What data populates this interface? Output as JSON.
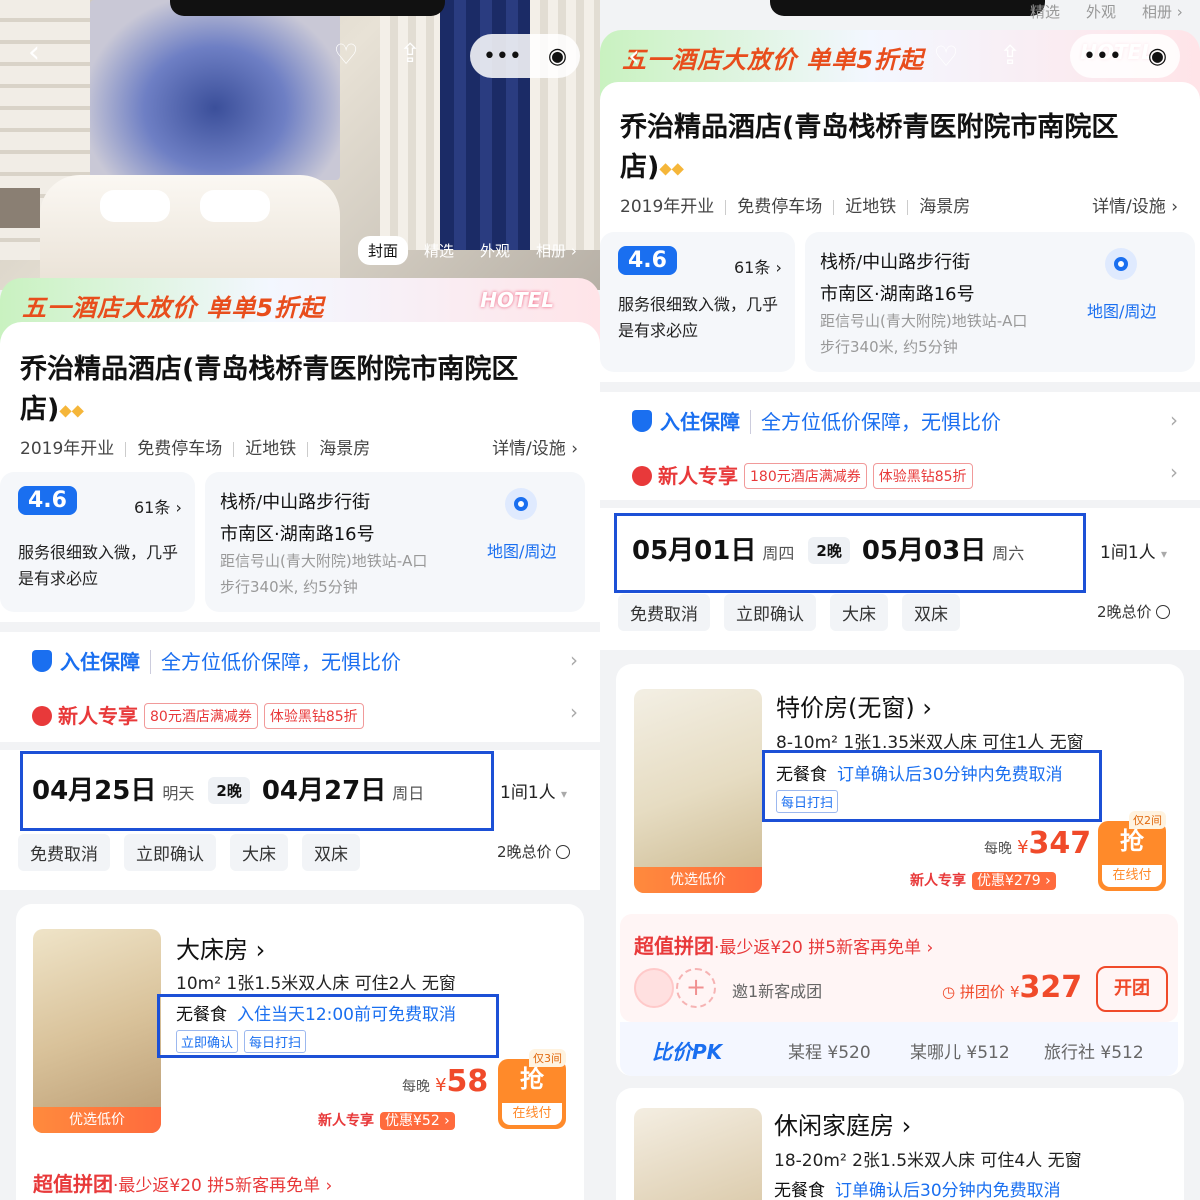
{
  "common": {
    "hotel_title": "乔治精品酒店(青岛栈桥青医附院市南院区店)",
    "diamonds": "◆◆",
    "features": [
      "2019年开业",
      "免费停车场",
      "近地铁",
      "海景房"
    ],
    "detail_link": "详情/设施 ›",
    "score": "4.6",
    "review_count": "61条 ›",
    "review_snippet": "服务很细致入微，几乎是有求必应",
    "address_line1": "栈桥/中山路步行街",
    "address_line2": "市南区·湖南路16号",
    "address_line3": "距信号山(青大附院)地铁站-A口",
    "address_line4": "步行340米, 约5分钟",
    "map_link": "地图/周边",
    "guarantee_title": "入住保障",
    "guarantee_desc": "全方位低价保障，无惧比价",
    "newuser_title": "新人专享",
    "newuser_tag2": "体验黑钻85折",
    "rooms_guests": "1间1人",
    "chips": [
      "免费取消",
      "立即确认",
      "大床",
      "双床"
    ],
    "total_price": "2晚总价",
    "banner": "五一酒店大放价 单单5折起",
    "banner_logo": "HOTEL",
    "photo_tabs": [
      "封面",
      "精选",
      "外观",
      "相册 ›"
    ],
    "nights": "2晚",
    "room_img_label": "优选低价",
    "per_night": "每晚",
    "currency": "¥",
    "grab": "抢",
    "online_pay": "在线付",
    "new_badge": "新人专享",
    "group_title": "超值拼团",
    "group_desc": "·最少返¥20 拼5新客再免单 ›",
    "daily_clean": "每日打扫",
    "no_breakfast": "无餐食"
  },
  "left": {
    "newuser_tag1": "80元酒店满减券",
    "checkin_date": "04月25日",
    "checkin_day": "明天",
    "checkout_date": "04月27日",
    "checkout_day": "周日",
    "room": {
      "name": "大床房 ›",
      "spec": "10m²  1张1.5米双人床  可住2人  无窗",
      "cancel": "入住当天12:00前可免费取消",
      "tag1": "立即确认",
      "price": "58",
      "limit": "仅3间",
      "discount": "优惠¥52 ›"
    }
  },
  "right": {
    "newuser_tag1": "180元酒店满减券",
    "checkin_date": "05月01日",
    "checkin_day": "周四",
    "checkout_date": "05月03日",
    "checkout_day": "周六",
    "room": {
      "name": "特价房(无窗) ›",
      "spec": "8-10m²  1张1.35米双人床  可住1人  无窗",
      "cancel": "订单确认后30分钟内免费取消",
      "price": "347",
      "limit": "仅2间",
      "discount": "优惠¥279 ›"
    },
    "group_invite": "邀1新客成团",
    "group_price_label": "◷ 拼团价",
    "group_price": "327",
    "group_button": "开团",
    "pk_title": "比价PK",
    "pk_items": [
      "某程 ¥520",
      "某哪儿 ¥512",
      "旅行社 ¥512"
    ],
    "room2": {
      "name": "休闲家庭房 ›",
      "spec": "18-20m²  2张1.5米双人床  可住4人  无窗",
      "cancel": "订单确认后30分钟内免费取消"
    }
  },
  "icons": [
    "back-icon",
    "heart-icon",
    "share-icon",
    "more-icon",
    "close-circle-icon",
    "shield-icon",
    "gift-icon",
    "location-pin-icon",
    "chevron-right-icon",
    "checkbox-icon",
    "plus-icon"
  ],
  "colors": {
    "accent": "#1a6ff0",
    "price": "#f04a2a",
    "highlight_box": "#1c50d6",
    "grab_button": "#ff8a2a"
  }
}
